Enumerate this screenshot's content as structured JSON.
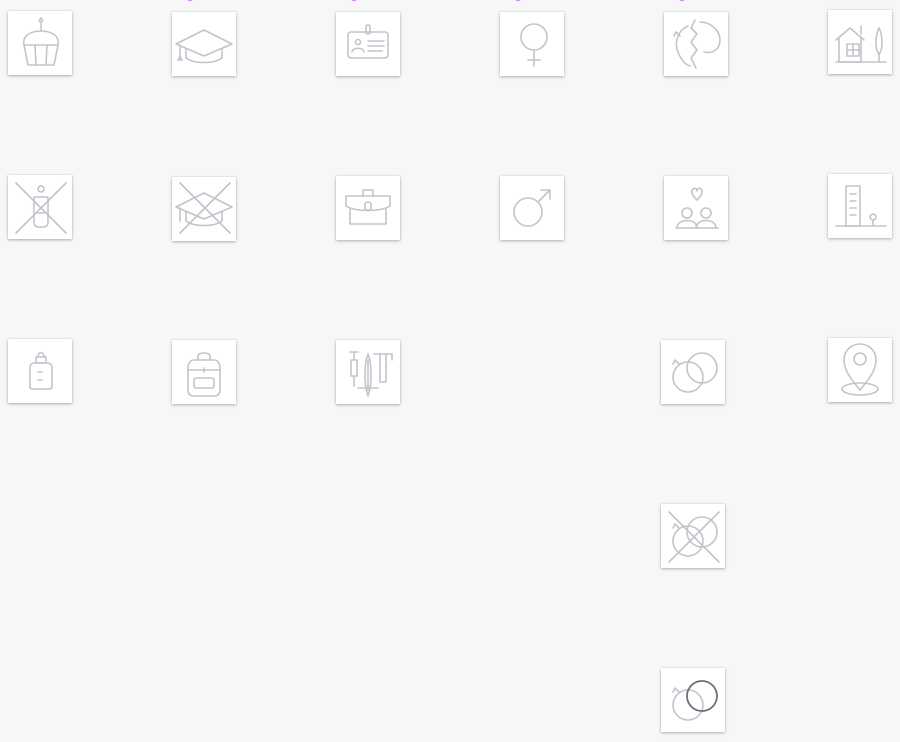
{
  "icons": [
    {
      "name": "birthday-cupcake-icon"
    },
    {
      "name": "graduation-cap-icon"
    },
    {
      "name": "id-card-icon"
    },
    {
      "name": "female-symbol-icon"
    },
    {
      "name": "broken-relationship-icon"
    },
    {
      "name": "house-with-tree-icon"
    },
    {
      "name": "no-children-icon"
    },
    {
      "name": "no-education-icon"
    },
    {
      "name": "briefcase-icon"
    },
    {
      "name": "male-symbol-icon"
    },
    {
      "name": "couple-with-heart-icon"
    },
    {
      "name": "office-building-icon"
    },
    {
      "name": "baby-bottle-icon"
    },
    {
      "name": "school-backpack-icon"
    },
    {
      "name": "work-tools-icon"
    },
    {
      "name": "interlocking-rings-icon"
    },
    {
      "name": "location-pin-icon"
    },
    {
      "name": "not-married-icon"
    },
    {
      "name": "married-rings-highlighted-icon"
    }
  ],
  "colors": {
    "background": "#f7f7f7",
    "tile": "#ffffff",
    "icon_stroke": "#c4c3cc",
    "icon_highlight": "#6e6d7c",
    "accent": "#cf7cf0"
  }
}
